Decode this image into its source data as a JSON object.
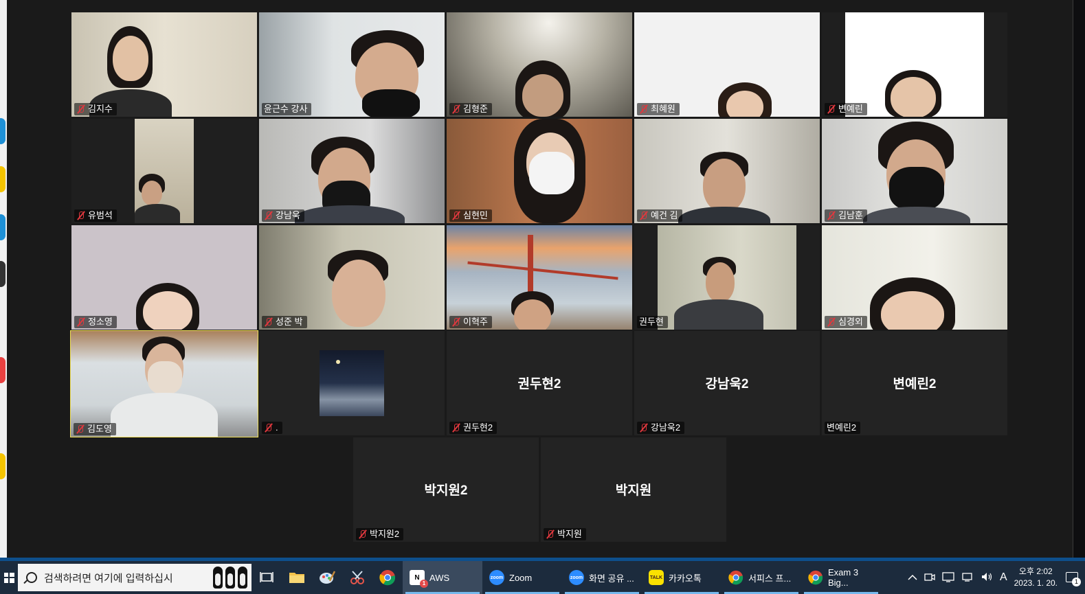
{
  "gallery": {
    "participants": [
      {
        "name": "김지수",
        "muted": true
      },
      {
        "name": "윤근수 강사",
        "muted": false
      },
      {
        "name": "김형준",
        "muted": true
      },
      {
        "name": "최혜원",
        "muted": true
      },
      {
        "name": "변예린",
        "muted": true
      },
      {
        "name": "유범석",
        "muted": true
      },
      {
        "name": "강남욱",
        "muted": true
      },
      {
        "name": "심현민",
        "muted": true
      },
      {
        "name": "예건 김",
        "muted": true
      },
      {
        "name": "김남훈",
        "muted": true
      },
      {
        "name": "정소영",
        "muted": true
      },
      {
        "name": "성준 박",
        "muted": true
      },
      {
        "name": "이혁주",
        "muted": true
      },
      {
        "name": "권두현",
        "muted": false
      },
      {
        "name": "심경외",
        "muted": true
      },
      {
        "name": "김도영",
        "muted": true,
        "active_speaker": true
      },
      {
        "name": ".",
        "muted": true
      },
      {
        "name": "권두현2",
        "muted": true,
        "big_name": "권두현2"
      },
      {
        "name": "강남욱2",
        "muted": true,
        "big_name": "강남욱2"
      },
      {
        "name": "변예린2",
        "muted": false,
        "big_name": "변예린2"
      },
      {
        "name": "박지원2",
        "muted": true,
        "big_name": "박지원2"
      },
      {
        "name": "박지원",
        "muted": true,
        "big_name": "박지원"
      }
    ]
  },
  "taskbar": {
    "search_placeholder": "검색하려면 여기에 입력하십시",
    "apps": [
      {
        "label": "AWS",
        "icon": "notion-icon"
      },
      {
        "label": "Zoom",
        "icon": "zoom-icon"
      },
      {
        "label": "화면 공유 ...",
        "icon": "zoom-icon"
      },
      {
        "label": "카카오톡",
        "icon": "kakaotalk-icon"
      },
      {
        "label": "서피스 프...",
        "icon": "chrome-icon"
      },
      {
        "label": "Exam 3 Big...",
        "icon": "chrome-icon"
      }
    ],
    "notion_badge": "1",
    "ime_label": "A",
    "clock_time": "오후 2:02",
    "clock_date": "2023. 1. 20.",
    "notification_count": "1",
    "zoom_icon_text": "zoom",
    "kakao_icon_text": "TALK"
  }
}
